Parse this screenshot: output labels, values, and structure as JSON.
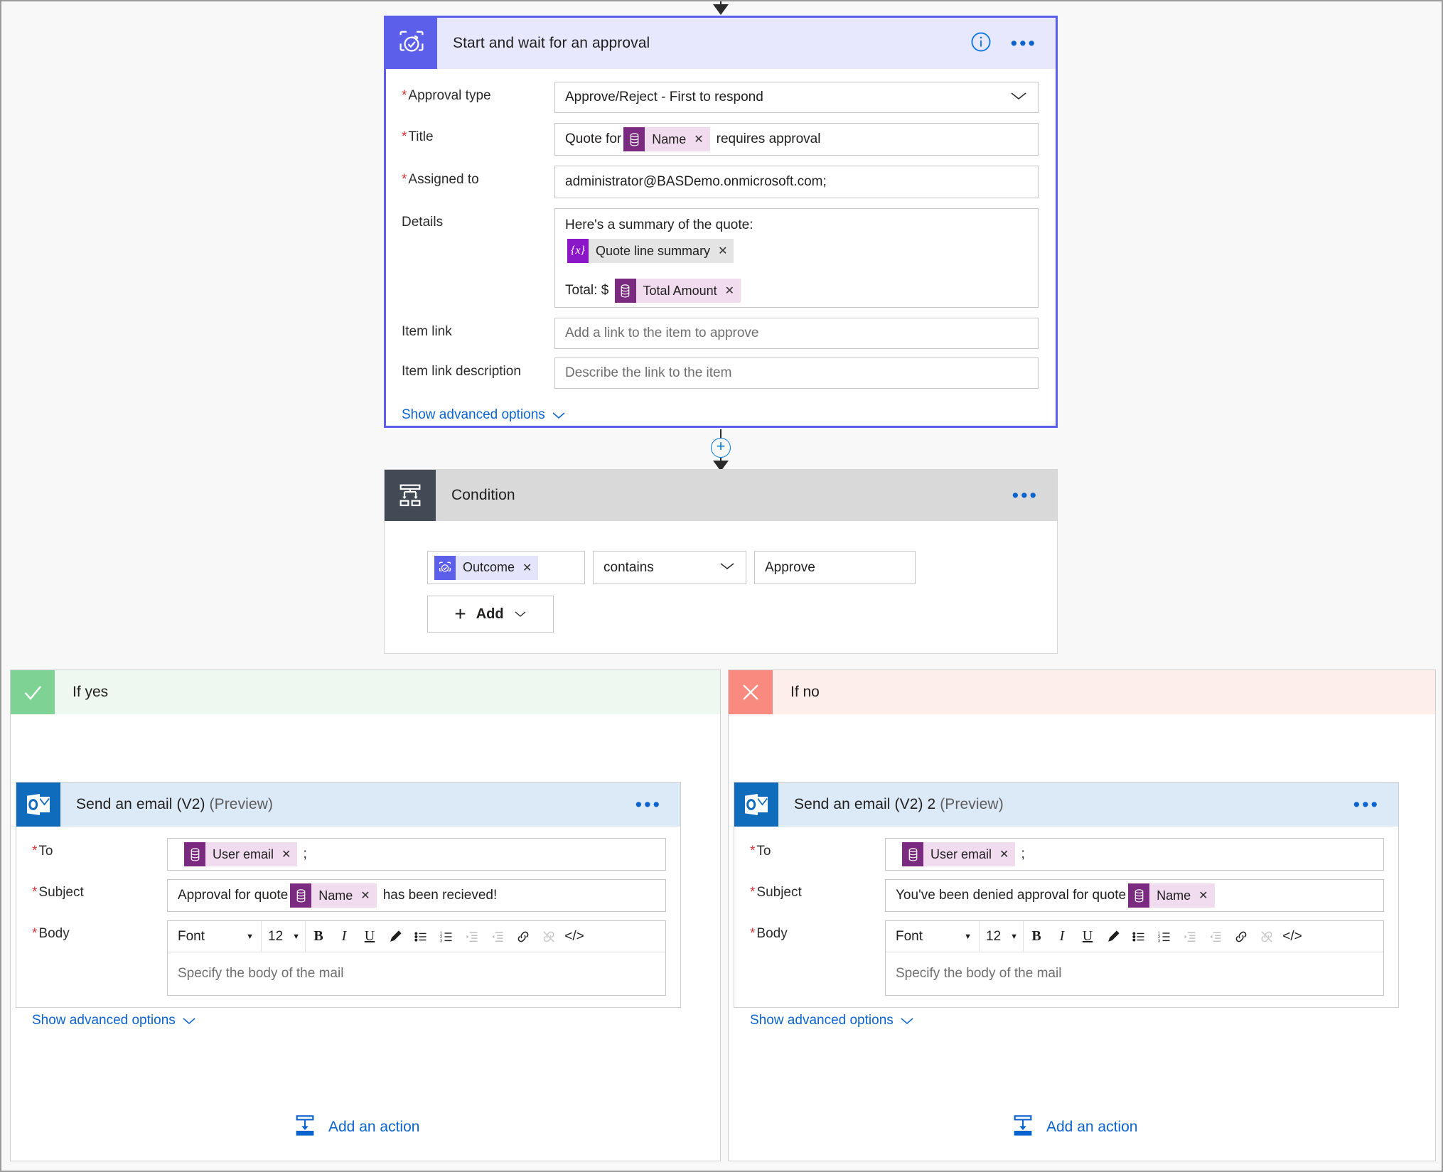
{
  "approval": {
    "title": "Start and wait for an approval",
    "icon": "approval-icon",
    "info_icon": "info-icon",
    "more_icon": "ellipsis-icon",
    "fields": {
      "approval_type": {
        "label": "Approval type",
        "required": true,
        "value": "Approve/Reject - First to respond"
      },
      "title": {
        "label": "Title",
        "required": true,
        "prefix": "Quote for",
        "token": "Name",
        "suffix": "requires approval"
      },
      "assigned_to": {
        "label": "Assigned to",
        "required": true,
        "value": "administrator@BASDemo.onmicrosoft.com;"
      },
      "details": {
        "label": "Details",
        "required": false,
        "line1": "Here's a summary of the quote:",
        "token1": "Quote line summary",
        "total_prefix": "Total: $",
        "token2": "Total Amount"
      },
      "item_link": {
        "label": "Item link",
        "required": false,
        "placeholder": "Add a link to the item to approve"
      },
      "item_link_description": {
        "label": "Item link description",
        "required": false,
        "placeholder": "Describe the link to the item"
      }
    },
    "advanced_link": "Show advanced options"
  },
  "condition": {
    "title": "Condition",
    "icon": "condition-icon",
    "more_icon": "ellipsis-icon",
    "row": {
      "left_token": "Outcome",
      "operator": "contains",
      "value": "Approve"
    },
    "add_button": "Add"
  },
  "branch_yes": {
    "label": "If yes",
    "icon": "check-icon",
    "add_action": "Add an action",
    "email": {
      "title": "Send an email (V2)",
      "title_suffix": "(Preview)",
      "icon": "outlook-icon",
      "more_icon": "ellipsis-icon",
      "to": {
        "label": "To",
        "required": true,
        "token": "User email",
        "suffix": ";"
      },
      "subject": {
        "label": "Subject",
        "required": true,
        "prefix": "Approval for quote",
        "token": "Name",
        "suffix": "has been recieved!"
      },
      "body": {
        "label": "Body",
        "required": true,
        "placeholder": "Specify the body of the mail",
        "toolbar": {
          "font": "Font",
          "size": "12",
          "bold": "B",
          "italic": "I",
          "underline": "U",
          "text_color": "pen-icon",
          "bullet_list": "bullet-list-icon",
          "numbered_list": "numbered-list-icon",
          "indent": "indent-icon",
          "outdent": "outdent-icon",
          "link": "link-icon",
          "unlink": "unlink-icon",
          "code": "code-view-icon"
        }
      },
      "advanced_link": "Show advanced options"
    }
  },
  "branch_no": {
    "label": "If no",
    "icon": "cross-icon",
    "add_action": "Add an action",
    "email": {
      "title": "Send an email (V2) 2",
      "title_suffix": "(Preview)",
      "icon": "outlook-icon",
      "more_icon": "ellipsis-icon",
      "to": {
        "label": "To",
        "required": true,
        "token": "User email",
        "suffix": ";"
      },
      "subject": {
        "label": "Subject",
        "required": true,
        "prefix": "You've been denied approval for quote",
        "token": "Name",
        "suffix": ""
      },
      "body": {
        "label": "Body",
        "required": true,
        "placeholder": "Specify the body of the mail",
        "toolbar": {
          "font": "Font",
          "size": "12",
          "bold": "B",
          "italic": "I",
          "underline": "U",
          "text_color": "pen-icon",
          "bullet_list": "bullet-list-icon",
          "numbered_list": "numbered-list-icon",
          "indent": "indent-icon",
          "outdent": "outdent-icon",
          "link": "link-icon",
          "unlink": "unlink-icon",
          "code": "code-view-icon"
        }
      },
      "advanced_link": "Show advanced options"
    }
  },
  "colors": {
    "approval_accent": "#5b5fe9",
    "condition_accent": "#424a55",
    "outlook_accent": "#0f6cbd",
    "yes_accent": "#7ed394",
    "no_accent": "#f98a80",
    "link": "#0b63ce",
    "required": "#d13438",
    "dataverse_token": "#7a2b7f",
    "variable_token": "#8a18c9"
  }
}
